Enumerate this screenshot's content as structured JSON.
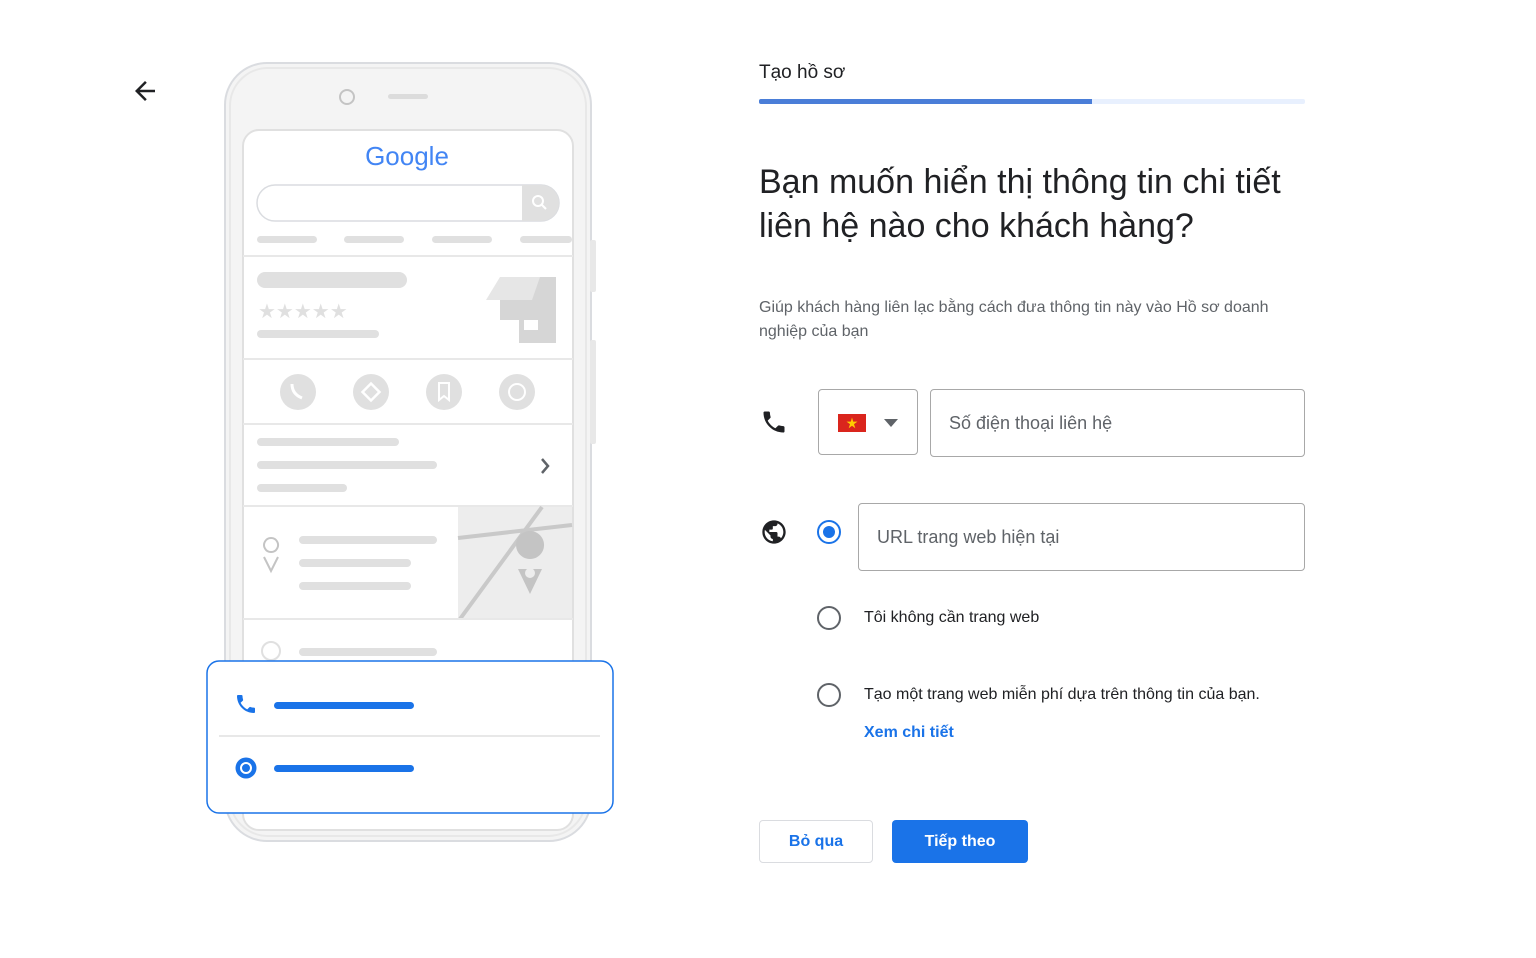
{
  "illustration": {
    "brand_logo_text": "Google"
  },
  "step": {
    "title": "Tạo hồ sơ",
    "progress_fraction": 0.61
  },
  "main": {
    "heading": "Bạn muốn hiển thị thông tin chi tiết liên hệ nào cho khách hàng?",
    "subtext": "Giúp khách hàng liên lạc bằng cách đưa thông tin này vào Hồ sơ doanh nghiệp của bạn"
  },
  "phone": {
    "country_flag": "vietnam-flag",
    "placeholder": "Số điện thoại liên hệ"
  },
  "website": {
    "url_placeholder": "URL trang web hiện tại",
    "option_none": "Tôi không cần trang web",
    "option_free": "Tạo một trang web miễn phí dựa trên thông tin của bạn.",
    "learn_more": "Xem chi tiết",
    "selected": "url"
  },
  "actions": {
    "skip_label": "Bỏ qua",
    "next_label": "Tiếp theo"
  },
  "colors": {
    "accent": "#1a73e8",
    "progress": "#4a7ed8",
    "progress_track": "#e8f0fe"
  }
}
